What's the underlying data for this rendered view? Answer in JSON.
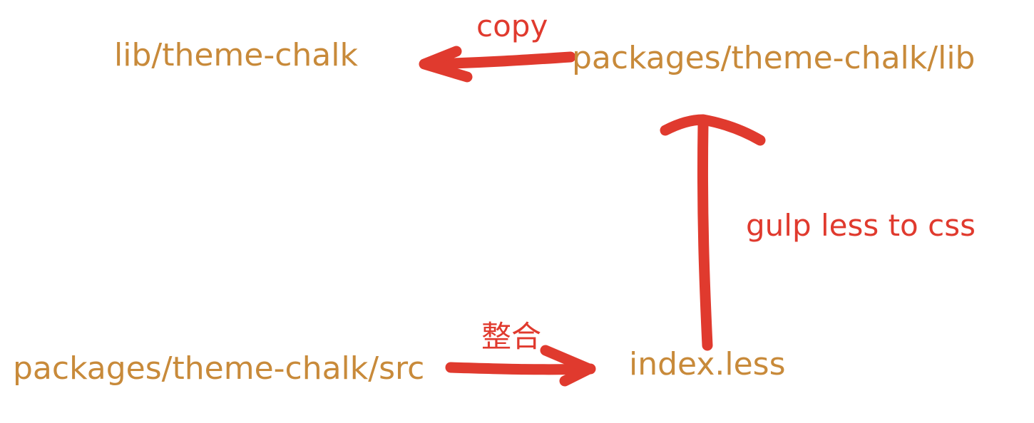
{
  "colors": {
    "node_text": "#c88a3a",
    "arrow": "#e03a2e",
    "label_text": "#e03a2e",
    "background": "#ffffff"
  },
  "nodes": {
    "lib_theme_chalk": "lib/theme-chalk",
    "packages_theme_chalk_lib": "packages/theme-chalk/lib",
    "packages_theme_chalk_src": "packages/theme-chalk/src",
    "index_less": "index.less"
  },
  "edges": {
    "copy": {
      "label": "copy",
      "from": "packages/theme-chalk/lib",
      "to": "lib/theme-chalk"
    },
    "gulp": {
      "label": "gulp less to css",
      "from": "index.less",
      "to": "packages/theme-chalk/lib"
    },
    "merge": {
      "label": "整合",
      "from": "packages/theme-chalk/src",
      "to": "index.less"
    }
  }
}
